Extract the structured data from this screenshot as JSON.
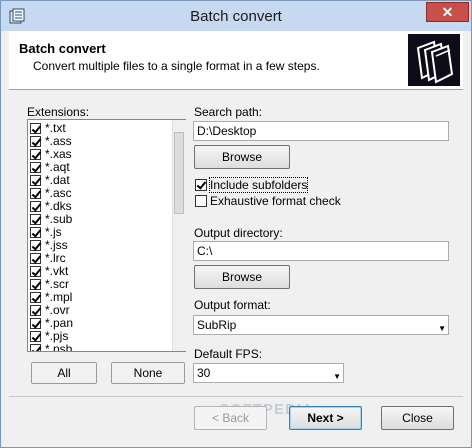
{
  "window": {
    "title": "Batch convert",
    "close_glyph": "✕"
  },
  "header": {
    "title": "Batch convert",
    "subtitle": "Convert multiple files to a single format in a few steps."
  },
  "extensions": {
    "label": "Extensions:",
    "items": [
      {
        "label": "*.txt",
        "checked": true
      },
      {
        "label": "*.ass",
        "checked": true
      },
      {
        "label": "*.xas",
        "checked": true
      },
      {
        "label": "*.aqt",
        "checked": true
      },
      {
        "label": "*.dat",
        "checked": true
      },
      {
        "label": "*.asc",
        "checked": true
      },
      {
        "label": "*.dks",
        "checked": true
      },
      {
        "label": "*.sub",
        "checked": true
      },
      {
        "label": "*.js",
        "checked": true
      },
      {
        "label": "*.jss",
        "checked": true
      },
      {
        "label": "*.lrc",
        "checked": true
      },
      {
        "label": "*.vkt",
        "checked": true
      },
      {
        "label": "*.scr",
        "checked": true
      },
      {
        "label": "*.mpl",
        "checked": true
      },
      {
        "label": "*.ovr",
        "checked": true
      },
      {
        "label": "*.pan",
        "checked": true
      },
      {
        "label": "*.pjs",
        "checked": true
      },
      {
        "label": "*.psb",
        "checked": true
      }
    ],
    "all_label": "All",
    "none_label": "None"
  },
  "search": {
    "label": "Search path:",
    "value": "D:\\Desktop",
    "browse_label": "Browse",
    "include_subfolders_label": "Include subfolders",
    "include_subfolders_checked": true,
    "exhaustive_label": "Exhaustive format check",
    "exhaustive_checked": false
  },
  "output": {
    "dir_label": "Output directory:",
    "dir_value": "C:\\",
    "browse_label": "Browse",
    "format_label": "Output format:",
    "format_value": "SubRip",
    "fps_label": "Default FPS:",
    "fps_value": "30"
  },
  "footer": {
    "back_label": "< Back",
    "next_label": "Next >",
    "close_label": "Close"
  },
  "watermark": "SOFTPEDIA"
}
